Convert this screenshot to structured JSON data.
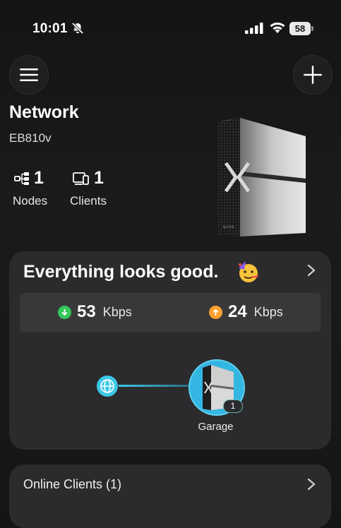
{
  "status_bar": {
    "time": "10:01",
    "battery": "58"
  },
  "header": {
    "title": "Network",
    "model": "EB810v"
  },
  "stats": {
    "nodes_count": "1",
    "nodes_label": "Nodes",
    "clients_count": "1",
    "clients_label": "Clients"
  },
  "status_card": {
    "title": "Everything looks good.",
    "download_value": "53",
    "download_unit": "Kbps",
    "upload_value": "24",
    "upload_unit": "Kbps",
    "node_name": "Garage",
    "node_badge": "1"
  },
  "clients_card": {
    "title": "Online Clients (1)"
  },
  "colors": {
    "download": "#34c759",
    "upload": "#ff9f2e",
    "accent": "#3cc8e6",
    "card_bg": "#2b2b2d"
  },
  "icons": [
    "bell-slash-icon",
    "signal-icon",
    "wifi-icon",
    "menu-icon",
    "plus-icon",
    "nodes-icon",
    "clients-icon",
    "party-face-emoji",
    "chevron-right-icon",
    "download-arrow-icon",
    "upload-arrow-icon",
    "globe-icon"
  ]
}
